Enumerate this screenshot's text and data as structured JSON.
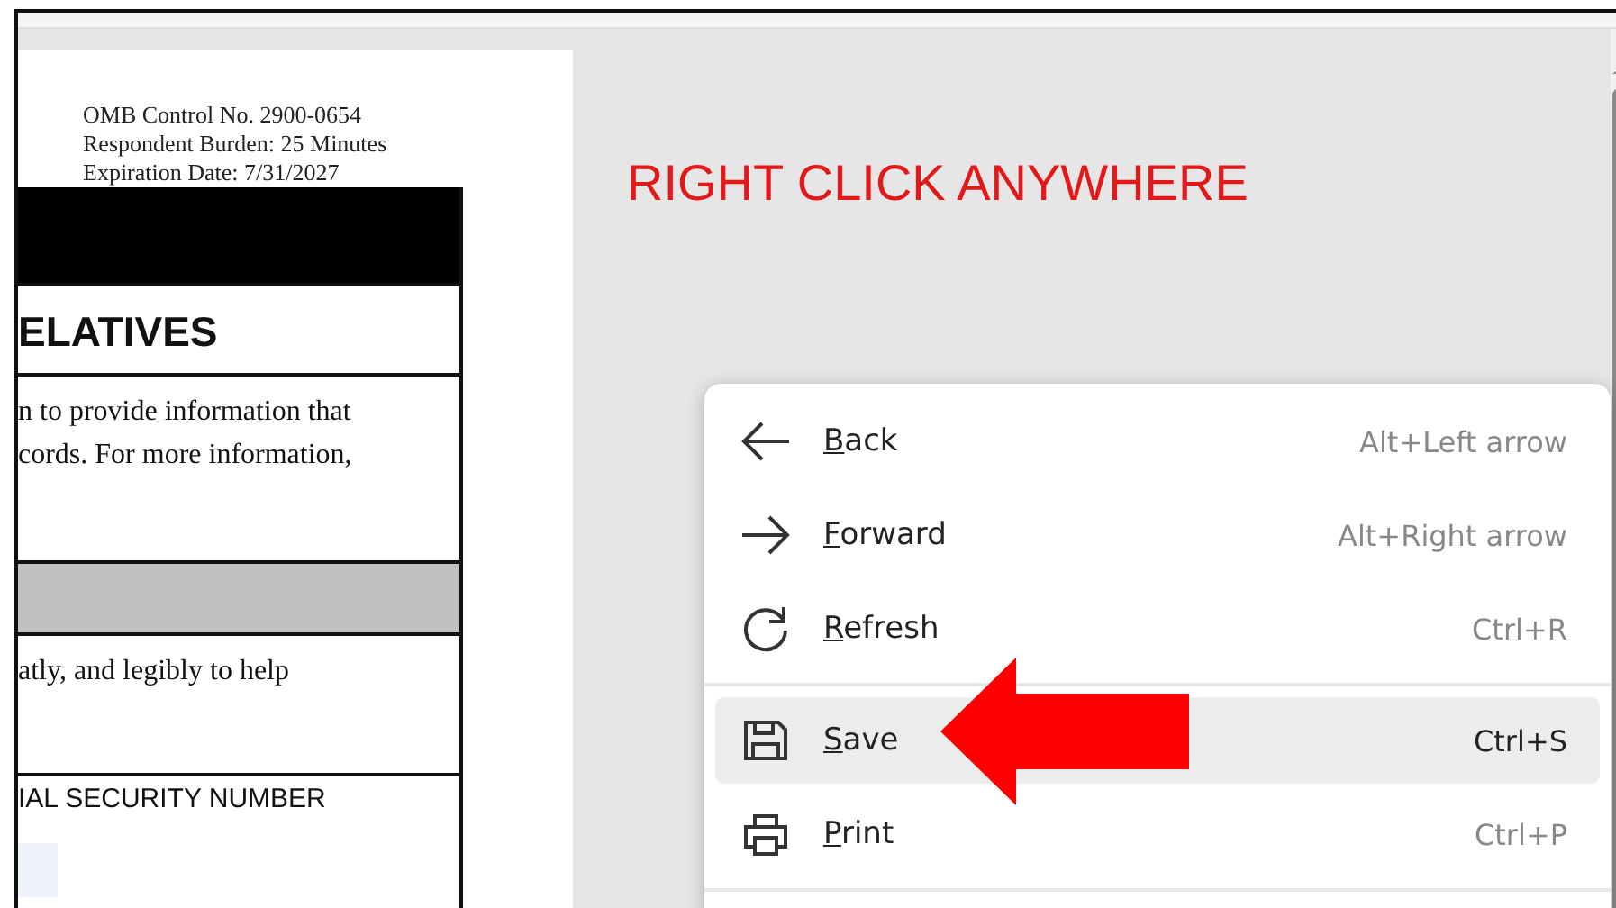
{
  "document": {
    "header_lines": [
      "OMB Control No. 2900-0654",
      "Respondent Burden:  25 Minutes",
      "Expiration Date:  7/31/2027"
    ],
    "title": "ELATIVES",
    "intro_lines": [
      "n to provide information that",
      "cords. For more information,"
    ],
    "instruction": "atly, and legibly to help",
    "field_label": "IAL SECURITY NUMBER"
  },
  "overlay_text": "RIGHT CLICK ANYWHERE",
  "context_menu": {
    "items": [
      {
        "kind": "item",
        "label": "Back",
        "shortcut": "Alt+Left arrow",
        "selected": false
      },
      {
        "kind": "item",
        "label": "Forward",
        "shortcut": "Alt+Right arrow",
        "selected": false
      },
      {
        "kind": "item",
        "label": "Refresh",
        "shortcut": "Ctrl+R",
        "selected": false
      },
      {
        "kind": "divider"
      },
      {
        "kind": "item",
        "label": "Save",
        "shortcut": "Ctrl+S",
        "selected": true
      },
      {
        "kind": "item",
        "label": "Print",
        "shortcut": "Ctrl+P",
        "selected": false
      },
      {
        "kind": "divider"
      }
    ]
  }
}
